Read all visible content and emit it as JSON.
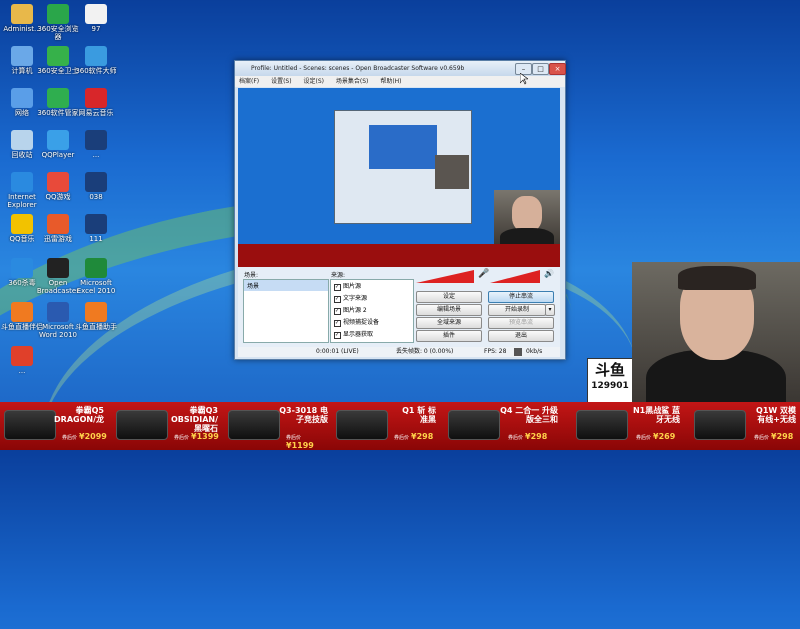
{
  "desktop": {
    "icons": [
      {
        "label": "Administ...",
        "color": "#e8b84a"
      },
      {
        "label": "360安全浏览器",
        "color": "#2aa64a"
      },
      {
        "label": "97",
        "color": "#f2f2f2"
      },
      {
        "label": "计算机",
        "color": "#6aa8e8"
      },
      {
        "label": "360安全卫士",
        "color": "#36b14a"
      },
      {
        "label": "360软件大师",
        "color": "#3a9be0"
      },
      {
        "label": "网络",
        "color": "#5a9ee8"
      },
      {
        "label": "360软件管家",
        "color": "#2fae4f"
      },
      {
        "label": "网易云音乐",
        "color": "#d8262a"
      },
      {
        "label": "回收站",
        "color": "#b8d4ec"
      },
      {
        "label": "QQPlayer",
        "color": "#3aa0e8"
      },
      {
        "label": "...",
        "color": "#1a3e7a"
      },
      {
        "label": "Internet Explorer",
        "color": "#2a8ae0"
      },
      {
        "label": "QQ游戏",
        "color": "#e84a3a"
      },
      {
        "label": "038",
        "color": "#1a3e7a"
      },
      {
        "label": "QQ音乐",
        "color": "#f2c200"
      },
      {
        "label": "迅雷游戏",
        "color": "#e85a2a"
      },
      {
        "label": "111",
        "color": "#1a3e7a"
      },
      {
        "label": "360杀毒",
        "color": "#2a8ae0"
      },
      {
        "label": "Open Broadcaster",
        "color": "#222"
      },
      {
        "label": "Microsoft Excel 2010",
        "color": "#1f8a3a"
      },
      {
        "label": "斗鱼直播伴侣",
        "color": "#f07a20"
      },
      {
        "label": "Microsoft Word 2010",
        "color": "#2a5ab0"
      },
      {
        "label": "斗鱼直播助手",
        "color": "#f07a20"
      },
      {
        "label": "...",
        "color": "#e0402a"
      }
    ]
  },
  "obs": {
    "title": "Profile: Untitled - Scenes: scenes - Open Broadcaster Software v0.659b",
    "menu": [
      "档案(F)",
      "设置(S)",
      "设定(S)",
      "场景集合(S)",
      "帮助(H)"
    ],
    "scenes_label": "场景:",
    "scenes": [
      "场景"
    ],
    "sources_label": "来源:",
    "sources": [
      "图片源",
      "文字来源",
      "图片源 2",
      "视频捕捉设备",
      "显示器获取"
    ],
    "buttons": {
      "settings": "设定",
      "stop_stream": "停止串流",
      "edit_scene": "编辑场景",
      "start_recording": "开始录制",
      "global_sources": "全域来源",
      "preview_stream": "预览串流",
      "plugins": "插件",
      "exit": "退出"
    },
    "status": {
      "time": "0:00:01 (LIVE)",
      "dropped": "丢失帧数: 0 (0.00%)",
      "fps": "FPS: 28",
      "bitrate": "0kb/s"
    }
  },
  "overlay": {
    "badge_number": "129901"
  },
  "ads": [
    {
      "name": "拳霸Q5 DRAGON/龙",
      "price": "2099",
      "tag": "券后价"
    },
    {
      "name": "拳霸Q3 OBSIDIAN/黑曜石",
      "price": "1399",
      "tag": "券后价"
    },
    {
      "name": "Q3-3018 电子竞技版",
      "price": "1199",
      "tag": "券后价"
    },
    {
      "name": "Q1 斩 标准黑",
      "price": "298",
      "tag": "券后价"
    },
    {
      "name": "Q4 二合一 升级版全三和",
      "price": "298",
      "tag": "券后价"
    },
    {
      "name": "N1黑战鲨 蓝牙无线",
      "price": "269",
      "tag": "券后价"
    },
    {
      "name": "Q1W 双模 有线+无线",
      "price": "298",
      "tag": "券后价"
    }
  ]
}
